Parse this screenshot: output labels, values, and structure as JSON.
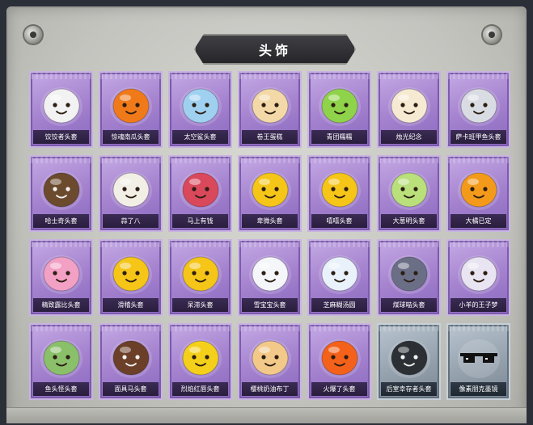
{
  "panel": {
    "title": "头饰"
  },
  "items": [
    {
      "label": "饺饺者头套",
      "icon": "dumpling-head-icon",
      "color": "#f2f2f2",
      "tone": "purple"
    },
    {
      "label": "惊魂南瓜头套",
      "icon": "pumpkin-head-icon",
      "color": "#f07a1a",
      "tone": "purple"
    },
    {
      "label": "太空鲨头套",
      "icon": "shark-head-icon",
      "color": "#9fd0f0",
      "tone": "purple"
    },
    {
      "label": "卷王蛋糕",
      "icon": "cake-roll-head-icon",
      "color": "#f3d9a8",
      "tone": "purple"
    },
    {
      "label": "青团糯糯",
      "icon": "green-rice-ball-head-icon",
      "color": "#8fd34a",
      "tone": "purple"
    },
    {
      "label": "烛光纪念",
      "icon": "candle-head-icon",
      "color": "#f6ead2",
      "tone": "purple"
    },
    {
      "label": "萨卡班甲鱼头套",
      "icon": "fish-head-icon",
      "color": "#d9dde3",
      "tone": "purple"
    },
    {
      "label": "哈士奇头套",
      "icon": "husky-head-icon",
      "color": "#6b4a2e",
      "tone": "purple"
    },
    {
      "label": "蒜了八",
      "icon": "garlic-head-icon",
      "color": "#f2efe6",
      "tone": "purple"
    },
    {
      "label": "马上有钱",
      "icon": "horse-head-icon",
      "color": "#d9485b",
      "tone": "purple"
    },
    {
      "label": "卑微头套",
      "icon": "yellow-face-head-icon",
      "color": "#f5c518",
      "tone": "purple"
    },
    {
      "label": "嘻嘻头套",
      "icon": "grin-face-head-icon",
      "color": "#f5c518",
      "tone": "purple"
    },
    {
      "label": "大葱明头套",
      "icon": "scallion-head-icon",
      "color": "#b9e07a",
      "tone": "purple"
    },
    {
      "label": "大橘已定",
      "icon": "orange-head-icon",
      "color": "#f39a1a",
      "tone": "purple"
    },
    {
      "label": "精致露比头套",
      "icon": "pink-bear-head-icon",
      "color": "#f2a0c4",
      "tone": "purple"
    },
    {
      "label": "滑稽头套",
      "icon": "funny-face-head-icon",
      "color": "#f5c518",
      "tone": "purple"
    },
    {
      "label": "呆滞头套",
      "icon": "blank-face-head-icon",
      "color": "#f5c518",
      "tone": "purple"
    },
    {
      "label": "雪宝宝头套",
      "icon": "snowman-head-icon",
      "color": "#f4f6fa",
      "tone": "purple"
    },
    {
      "label": "芝麻糊汤圆",
      "icon": "glutinous-ball-head-icon",
      "color": "#e9f2fb",
      "tone": "purple"
    },
    {
      "label": "煤球喵头套",
      "icon": "black-cat-head-icon",
      "color": "#6a6f86",
      "tone": "purple"
    },
    {
      "label": "小羊的王子梦",
      "icon": "sheep-head-icon",
      "color": "#e9e4f1",
      "tone": "purple"
    },
    {
      "label": "鱼头怪头套",
      "icon": "fish-monster-head-icon",
      "color": "#8bc06a",
      "tone": "purple"
    },
    {
      "label": "面具马头套",
      "icon": "horse-mask-head-icon",
      "color": "#6b3f28",
      "tone": "purple"
    },
    {
      "label": "烈焰红唇头套",
      "icon": "red-lips-head-icon",
      "color": "#f5d01a",
      "tone": "purple"
    },
    {
      "label": "樱桃奶油布丁",
      "icon": "pudding-head-icon",
      "color": "#f3c98a",
      "tone": "purple"
    },
    {
      "label": "火爆了头套",
      "icon": "fire-head-icon",
      "color": "#f4611a",
      "tone": "purple"
    },
    {
      "label": "后室幸存者头套",
      "icon": "gas-mask-head-icon",
      "color": "#2c2f33",
      "tone": "gray"
    },
    {
      "label": "像素朋克墨镜",
      "icon": "pixel-sunglasses-icon",
      "color": "#111111",
      "tone": "gray"
    }
  ]
}
